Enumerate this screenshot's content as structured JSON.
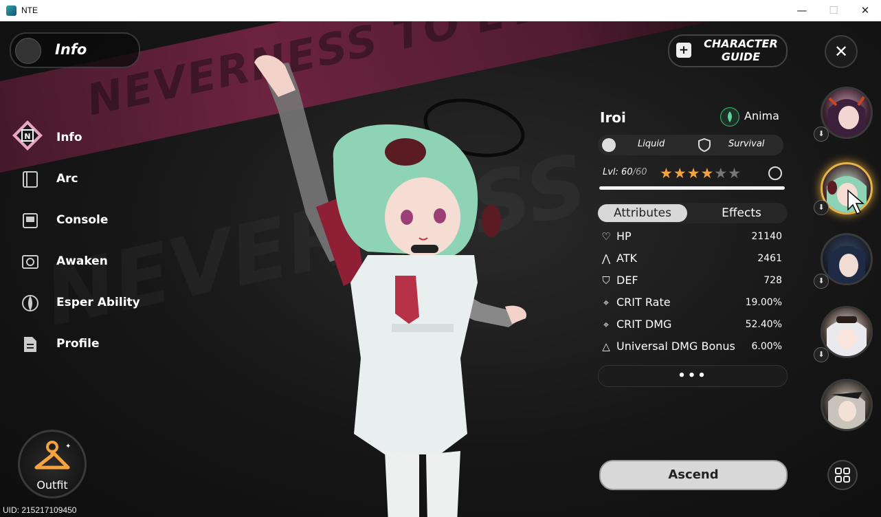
{
  "window": {
    "title": "NTE",
    "min": "—",
    "max": "☐",
    "close": "✕"
  },
  "header": {
    "label": "Info",
    "guide_line1": "CHARACTER",
    "guide_line2": "GUIDE",
    "close": "✕"
  },
  "nav": [
    {
      "label": "Info",
      "icon": "info-icon",
      "active": true
    },
    {
      "label": "Arc",
      "icon": "arc-icon"
    },
    {
      "label": "Console",
      "icon": "console-icon"
    },
    {
      "label": "Awaken",
      "icon": "awaken-icon"
    },
    {
      "label": "Esper Ability",
      "icon": "esper-ability-icon"
    },
    {
      "label": "Profile",
      "icon": "profile-icon"
    }
  ],
  "outfit": {
    "label": "Outfit"
  },
  "uid": "UID: 215217109450",
  "character": {
    "name": "Iroi",
    "element": "Anima",
    "tag1": "Liquid",
    "tag2": "Survival",
    "level_label": "Lvl: 60",
    "level_max": "/60",
    "level_fraction": 1.0,
    "stars_on": "★★★★",
    "stars_off": "★★"
  },
  "tabs": {
    "attributes": "Attributes",
    "effects": "Effects"
  },
  "stats": [
    {
      "name": "HP",
      "value": "21140",
      "icon": "♡"
    },
    {
      "name": "ATK",
      "value": "2461",
      "icon": "⋀"
    },
    {
      "name": "DEF",
      "value": "728",
      "icon": "⛉"
    },
    {
      "name": "CRIT Rate",
      "value": "19.00%",
      "icon": "⌖"
    },
    {
      "name": "CRIT DMG",
      "value": "52.40%",
      "icon": "⌖"
    },
    {
      "name": "Universal DMG Bonus",
      "value": "6.00%",
      "icon": "△"
    }
  ],
  "more": "•••",
  "ascend": "Ascend",
  "roster_download": "⬇",
  "colors": {
    "accent": "#e5b54b",
    "banner": "#7a2546",
    "hair": "#8fd3b6",
    "star": "#f4a340"
  }
}
